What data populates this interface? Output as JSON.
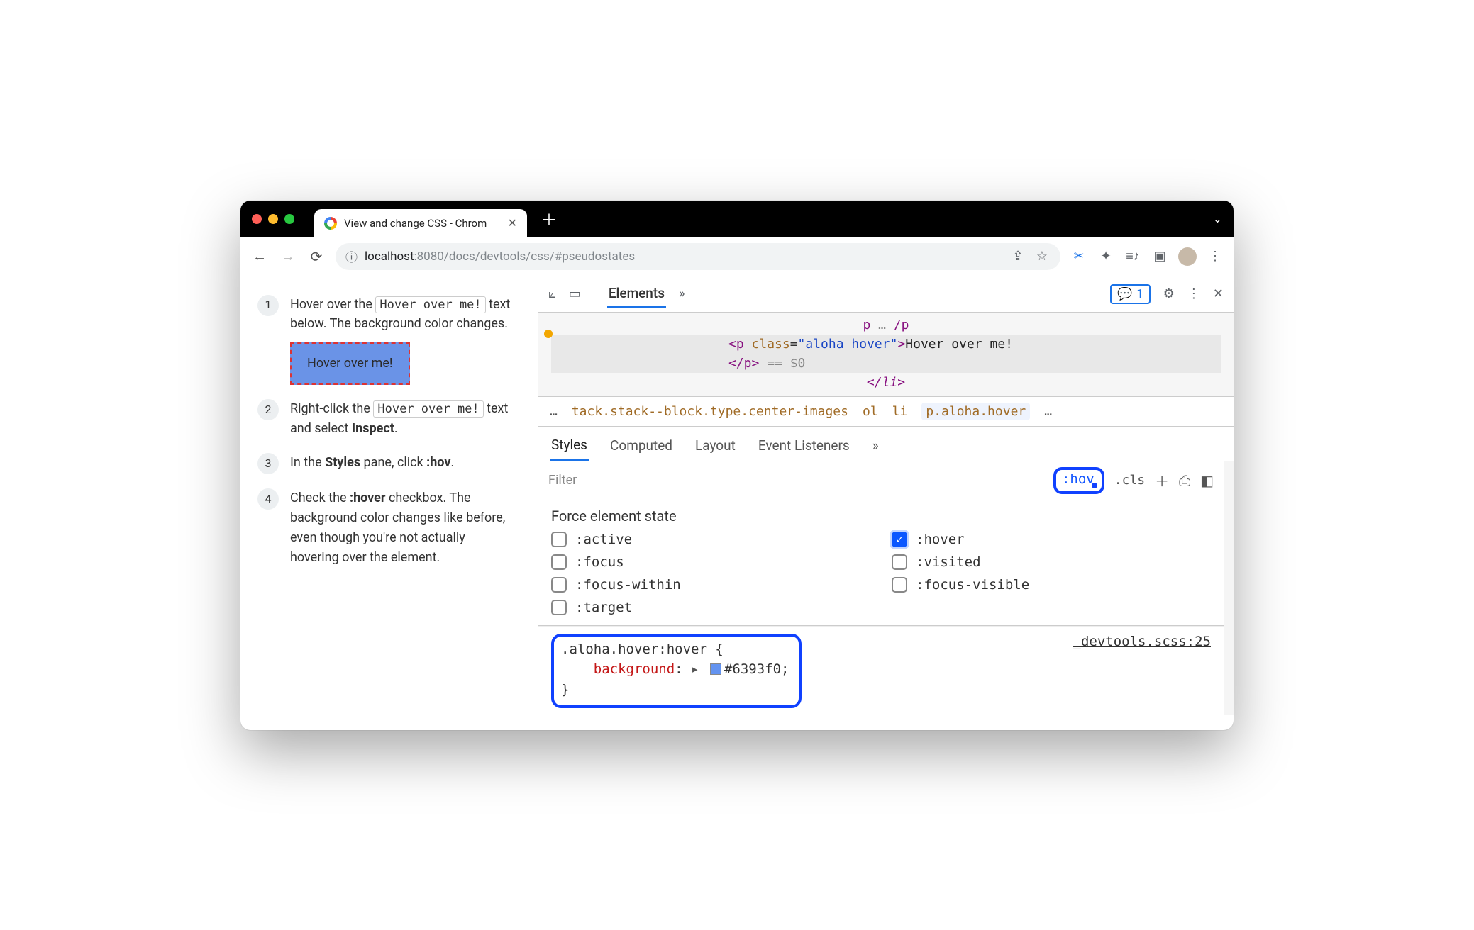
{
  "window": {
    "tab_title": "View and change CSS - Chrom",
    "chevron": "⌄"
  },
  "toolbar": {
    "url_host": "localhost",
    "url_port": ":8080",
    "url_path": "/docs/devtools/css/#pseudostates"
  },
  "page": {
    "steps": [
      {
        "n": "1",
        "pre": "Hover over the ",
        "code": "Hover over me!",
        "post": " text below. The background color changes."
      },
      {
        "n": "2",
        "pre": "Right-click the ",
        "code": "Hover over me!",
        "post": " text and select ",
        "bold": "Inspect",
        "post2": "."
      },
      {
        "n": "3",
        "pre": "In the ",
        "bold": "Styles",
        "post": " pane, click ",
        "bold2": ":hov",
        "post2": "."
      },
      {
        "n": "4",
        "pre": "Check the ",
        "bold": ":hover",
        "post": " checkbox. The background color changes like before, even though you're not actually hovering over the element."
      }
    ],
    "hover_box": "Hover over me!"
  },
  "devtools": {
    "top": {
      "elements": "Elements",
      "more": "»",
      "issues": "1"
    },
    "dom": {
      "prev": "p … /p",
      "open": "<p class=\"aloha hover\">",
      "text": "Hover over me!",
      "close": "</p>",
      "eq": " == $0",
      "next": "</li>"
    },
    "crumbs": {
      "ellipsis": "…",
      "c1": "tack.stack--block.type.center-images",
      "c2": "ol",
      "c3": "li",
      "c4": "p.aloha.hover"
    },
    "subtabs": {
      "styles": "Styles",
      "computed": "Computed",
      "layout": "Layout",
      "events": "Event Listeners",
      "more": "»"
    },
    "filter": {
      "placeholder": "Filter",
      "hov": ":hov",
      "cls": ".cls"
    },
    "force": {
      "title": "Force element state",
      "items": [
        {
          "label": ":active",
          "checked": false
        },
        {
          "label": ":hover",
          "checked": true
        },
        {
          "label": ":focus",
          "checked": false
        },
        {
          "label": ":visited",
          "checked": false
        },
        {
          "label": ":focus-within",
          "checked": false
        },
        {
          "label": ":focus-visible",
          "checked": false
        },
        {
          "label": ":target",
          "checked": false
        }
      ]
    },
    "rule": {
      "selector": ".aloha.hover:hover {",
      "prop": "background",
      "value": "#6393f0",
      "close": "}",
      "source": "_devtools.scss:25"
    }
  }
}
